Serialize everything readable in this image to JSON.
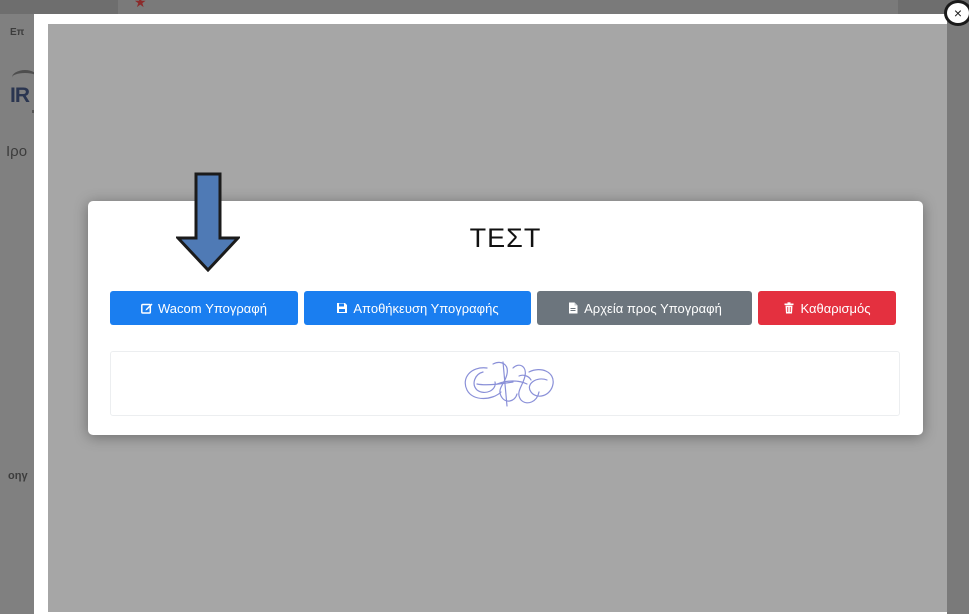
{
  "background": {
    "fragment_a": "Επ",
    "logo_letters": "IR",
    "fragment_b": "Ιρο",
    "fragment_c": "οηγ"
  },
  "modal": {
    "close_label": "×",
    "card": {
      "title": "ΤΕΣΤ",
      "buttons": {
        "wacom": {
          "label": "Wacom Υπογραφή",
          "icon": "edit-icon",
          "color": "#1a7ef0"
        },
        "save": {
          "label": "Αποθήκευση Υπογραφής",
          "icon": "floppy-disk-icon",
          "color": "#1a7ef0"
        },
        "files": {
          "label": "Αρχεία προς Υπογραφή",
          "icon": "file-icon",
          "color": "#6c757d"
        },
        "clear": {
          "label": "Καθαρισμός",
          "icon": "trash-icon",
          "color": "#e4303f"
        }
      }
    }
  },
  "annotation": {
    "icon": "down-arrow-icon",
    "color": "#4f7ab5"
  }
}
